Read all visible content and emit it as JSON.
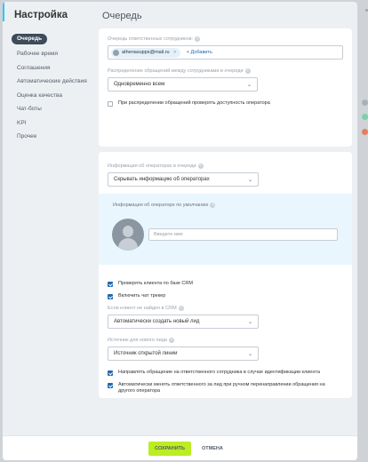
{
  "sidebar": {
    "title": "Настройка",
    "items": [
      {
        "label": "Очередь"
      },
      {
        "label": "Рабочее время"
      },
      {
        "label": "Соглашения"
      },
      {
        "label": "Автоматические действия"
      },
      {
        "label": "Оценка качества"
      },
      {
        "label": "Чат-боты"
      },
      {
        "label": "KPI"
      },
      {
        "label": "Прочее"
      }
    ]
  },
  "main": {
    "title": "Очередь",
    "responsible_label": "Очередь ответственных сотрудников:",
    "user_tag": "athenasupps@mail.ru",
    "add_label": "+ Добавить",
    "distribution_label": "Распределение обращений между сотрудниками в очереди",
    "distribution_value": "Одновременно всем",
    "check_availability": "При распределении обращений проверять доступность оператора",
    "operator_info_label": "Информация об операторах в очереди",
    "operator_info_value": "Скрывать информацию об операторах",
    "default_info_title": "Информация об операторе по умолчанию",
    "name_placeholder": "Введите имя",
    "check_crm": "Проверять клиента по базе CRM",
    "enable_tracker": "Включить чат трекер",
    "not_found_label": "Если клиент не найден в CRM",
    "not_found_value": "Автоматически создать новый лид",
    "lead_source_label": "Источник для нового лида",
    "lead_source_value": "Источник открытой линии",
    "route_to_responsible": "Направлять обращение на ответственного сотрудника в случае идентификации клиента",
    "auto_change_responsible": "Автоматически менять ответственного за лид при ручном перенаправлении обращения на другого оператора"
  },
  "footer": {
    "save": "СОХРАНИТЬ",
    "cancel": "ОТМЕНА"
  },
  "colors": {
    "accent": "#2fc6f6",
    "save_button": "#bbed21",
    "checkbox_on": "#2067b0",
    "active_nav": "#3d4b5a"
  }
}
